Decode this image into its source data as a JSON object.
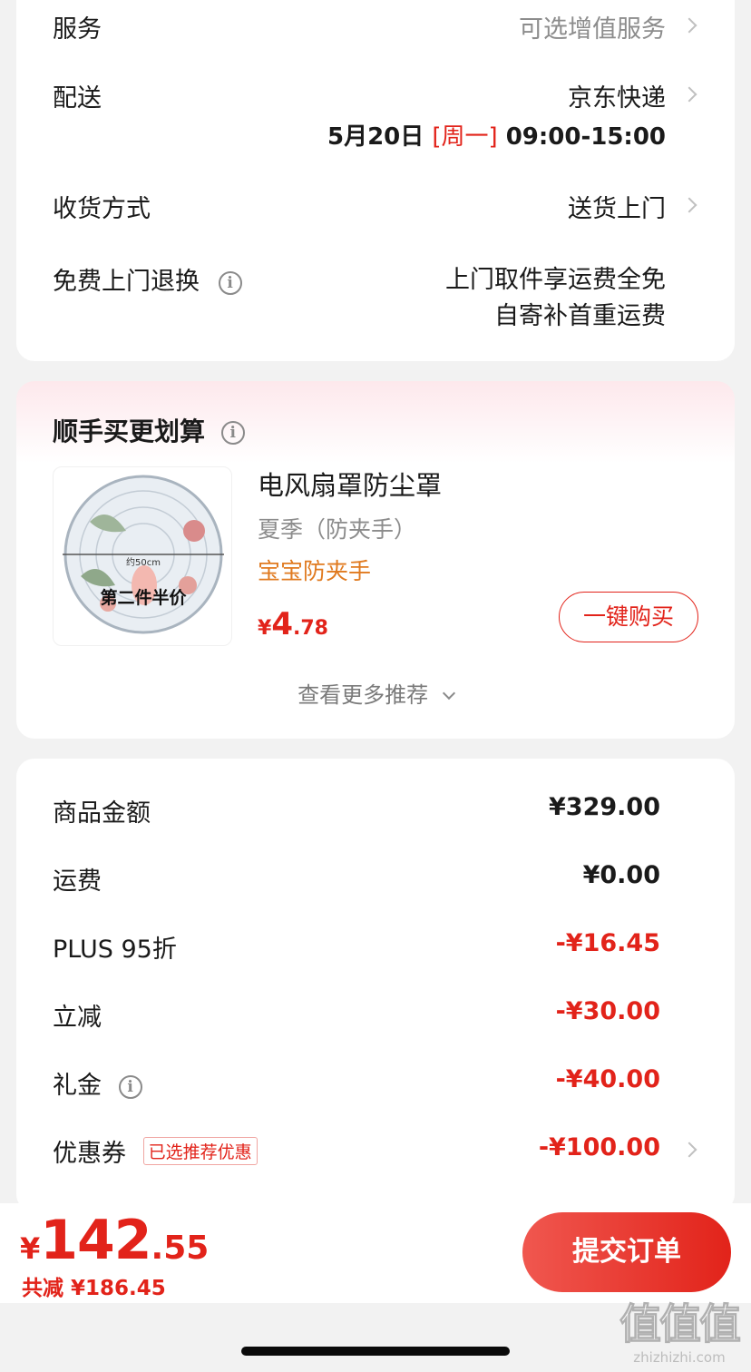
{
  "delivery_card": {
    "service_label": "服务",
    "service_value": "可选增值服务",
    "shipping_label": "配送",
    "shipping_value": "京东快递",
    "date_prefix": "5月20日",
    "date_weekday": "[周一]",
    "date_time": "09:00-15:00",
    "receive_label": "收货方式",
    "receive_value": "送货上门",
    "return_label": "免费上门退换",
    "return_line1": "上门取件享运费全免",
    "return_line2": "自寄补首重运费"
  },
  "recommend": {
    "title": "顺手买更划算",
    "product_name": "电风扇罩防尘罩",
    "product_spec": "夏季（防夹手）",
    "product_tag": "宝宝防夹手",
    "currency": "¥",
    "price_int": "4",
    "price_dec": ".78",
    "buy_label": "一键购买",
    "more_label": "查看更多推荐",
    "image_text_top": "约50cm",
    "image_text_main": "第二件半价"
  },
  "summary": {
    "rows": [
      {
        "label": "商品金额",
        "value": "¥329.00"
      },
      {
        "label": "运费",
        "value": "¥0.00"
      },
      {
        "label": "PLUS 95折",
        "value": "-¥16.45"
      },
      {
        "label": "立减",
        "value": "-¥30.00"
      },
      {
        "label": "礼金",
        "value": "-¥40.00"
      },
      {
        "label": "优惠券",
        "value": "-¥100.00"
      }
    ],
    "coupon_badge": "已选推荐优惠"
  },
  "bottom": {
    "currency": "¥",
    "total_int": "142",
    "total_dec": ".55",
    "saved_label": "共减 ¥186.45",
    "submit_label": "提交订单"
  },
  "watermark": {
    "logo": "值值值",
    "site": "zhizhizhi.com"
  },
  "colors": {
    "accent_red": "#e2231a",
    "tag_orange": "#e07a1f",
    "submit_gradient_start": "#f0574f",
    "submit_gradient_end": "#e2231a"
  }
}
